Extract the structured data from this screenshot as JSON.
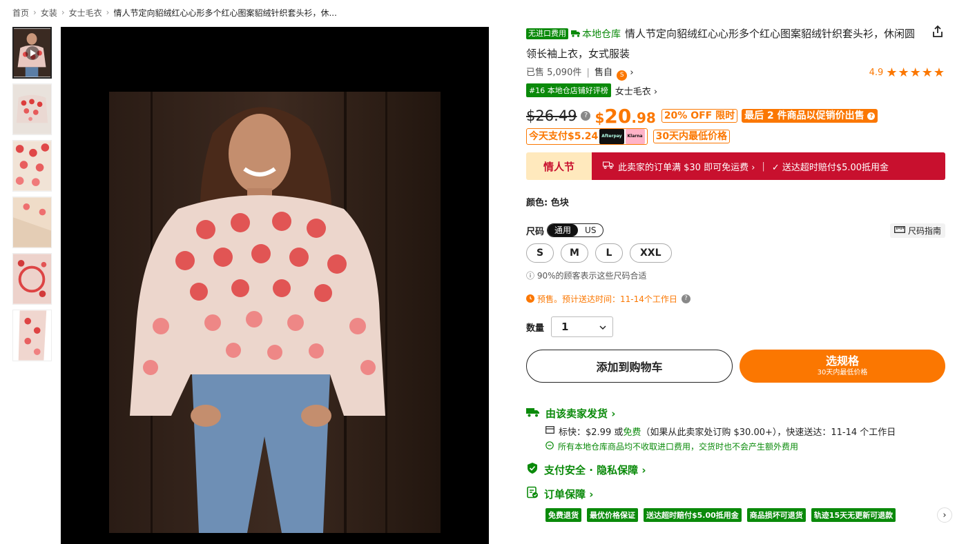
{
  "breadcrumb": {
    "items": [
      "首页",
      "女装",
      "女士毛衣"
    ],
    "current": "情人节定向貂绒红心心形多个红心图案貂绒针织套头衫，休..."
  },
  "product": {
    "badge_import_free": "无进口费用",
    "local_warehouse": "本地仓库",
    "title": "情人节定向貂绒红心心形多个红心图案貂绒针织套头衫，休闲圆领长袖上衣，女式服装",
    "sold": "已售 5,090件",
    "divider": "|",
    "self_operated": "售自",
    "seller_logo": "S",
    "rating": "4.9",
    "stars": "★★★★★",
    "rank_badge": "#16 本地仓店铺好评榜",
    "rank_category": "女士毛衣 ›"
  },
  "price": {
    "old": "$26.49",
    "currency": "$",
    "integer": "20",
    "decimal": ".98",
    "off_badge": "20% OFF 限时",
    "promo_badge": "最后 2 件商品以促销价出售",
    "pay_today": "今天支付$5.24",
    "afterpay": "Afterpay",
    "klarna": "Klarna",
    "lowest_30": "30天内最低价格"
  },
  "banner": {
    "label": "情人节",
    "free_ship": "此卖家的订单满 $30 即可免运费 ›",
    "late_comp": "✓ 送达超时赔付$5.00抵用金"
  },
  "color": {
    "label": "颜色: 色块"
  },
  "size": {
    "label": "尺码",
    "toggle_on": "通用",
    "toggle_off": "US",
    "guide": "尺码指南",
    "options": [
      "S",
      "M",
      "L",
      "XXL"
    ],
    "fit_note": "ⓘ 90%的顾客表示这些尺码合适"
  },
  "presale": {
    "text": "预售。预计送达时间：11-14个工作日"
  },
  "quantity": {
    "label": "数量",
    "value": "1"
  },
  "buttons": {
    "add_to_cart": "添加到购物车",
    "buy_main": "选规格",
    "buy_sub": "30天内最低价格"
  },
  "shipping": {
    "head": "由该卖家发货 ›",
    "line_prefix": "标快：$2.99 或 ",
    "line_free": "免费",
    "line_suffix": "（如果从此卖家处订购 $30.00+），快速送达：11-14 个工作日",
    "note": "所有本地仓库商品均不收取进口费用，交货时也不会产生额外费用"
  },
  "security": {
    "head": "支付安全 · 隐私保障 ›"
  },
  "guarantee": {
    "head": "订单保障 ›",
    "badges": [
      "免费退货",
      "最优价格保证",
      "送达超时赔付$5.00抵用金",
      "商品损坏可退货",
      "轨迹15天无更新可退款"
    ]
  },
  "colors": {
    "accent": "#fb7701",
    "green": "#0a8a0a",
    "banner_red": "#c8102e"
  }
}
